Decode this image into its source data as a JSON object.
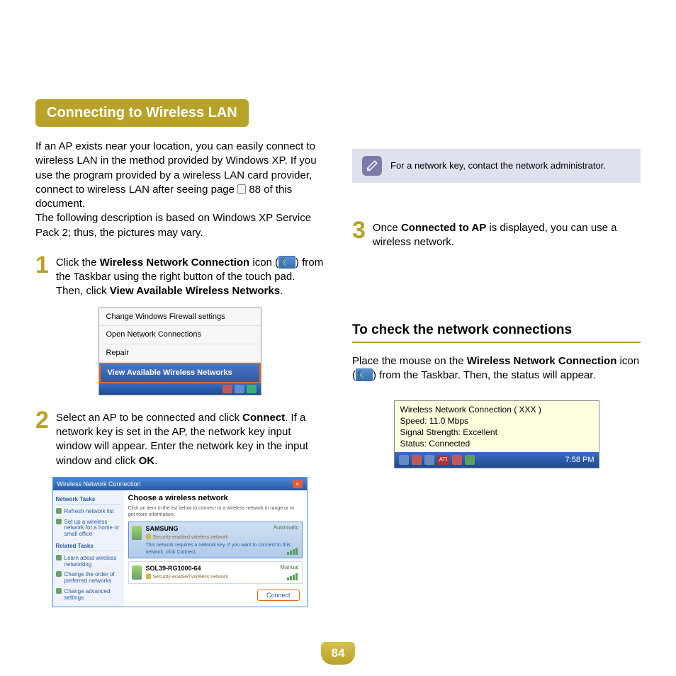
{
  "heading": "Connecting to Wireless LAN",
  "intro_p1a": "If an AP exists near your location, you can easily connect to wireless LAN in the method provided by Windows XP. If you use the program provided by a wireless LAN card provider, connect to wireless LAN after seeing page ",
  "intro_page_ref": "88",
  "intro_p1b": " of this document.",
  "intro_p2": "The following description is based on Windows XP Service Pack 2; thus, the pictures may vary.",
  "steps": {
    "s1": {
      "num": "1",
      "t1": "Click the ",
      "b1": "Wireless Network Connection",
      "t2": " icon (",
      "t3": ") from the Taskbar using the right button of the touch pad. Then, click ",
      "b2": "View Available Wireless Networks",
      "t4": "."
    },
    "s2": {
      "num": "2",
      "t1": "Select an AP to be connected and click ",
      "b1": "Connect",
      "t2": ". If a network key is set in the AP, the network key input window will appear. Enter the network key in the input window and click ",
      "b2": "OK",
      "t3": "."
    },
    "s3": {
      "num": "3",
      "t1": "Once ",
      "b1": "Connected to AP",
      "t2": " is displayed, you can use a wireless network."
    }
  },
  "ctxmenu": {
    "m1": "Change Windows Firewall settings",
    "m2": "Open Network Connections",
    "m3": "Repair",
    "m4": "View Available Wireless Networks"
  },
  "wdlg": {
    "title": "Wireless Network Connection",
    "side_hdr1": "Network Tasks",
    "side_i1": "Refresh network list",
    "side_i2": "Set up a wireless network for a home or small office",
    "side_hdr2": "Related Tasks",
    "side_i3": "Learn about wireless networking",
    "side_i4": "Change the order of preferred networks",
    "side_i5": "Change advanced settings",
    "main_h": "Choose a wireless network",
    "main_desc": "Click an item in the list below to connect to a wireless network in range or to get more information.",
    "net1_name": "SAMSUNG",
    "net1_auto": "Automatic",
    "net1_sec": "Security-enabled wireless network",
    "net1_desc": "This network requires a network key. If you want to connect to this network, click Connect.",
    "net2_name": "SOL39-RG1000-64",
    "net2_auto": "Manual",
    "net2_sec": "Security-enabled wireless network",
    "connect_btn": "Connect"
  },
  "note": "For a network key, contact the network administrator.",
  "subhead": "To check the network connections",
  "check": {
    "t1": "Place the mouse on the ",
    "b1": "Wireless Network Connection",
    "t2": " icon (",
    "t3": ") from the Taskbar. Then, the status will appear."
  },
  "tooltip": {
    "l1": "Wireless Network Connection (  XXX  )",
    "l2": "Speed: 11.0 Mbps",
    "l3": "Signal Strength: Excellent",
    "l4": "Status:  Connected",
    "ati": "ATI",
    "time": "7:58 PM"
  },
  "page_number": "84"
}
